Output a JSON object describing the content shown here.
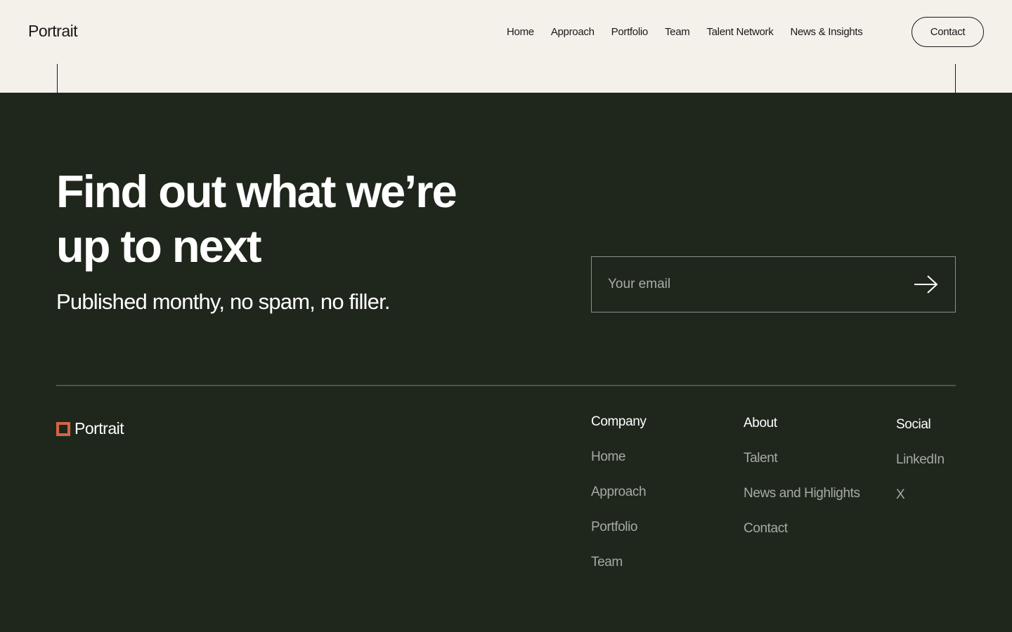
{
  "header": {
    "logo": "Portrait",
    "nav": [
      "Home",
      "Approach",
      "Portfolio",
      "Team",
      "Talent Network",
      "News & Insights"
    ],
    "contact_label": "Contact"
  },
  "newsletter": {
    "headline": "Find out what we’re up to next",
    "subtext": "Published monthy, no spam, no filler.",
    "email_placeholder": "Your email"
  },
  "footer": {
    "logo": "Portrait",
    "columns": {
      "company": {
        "title": "Company",
        "links": [
          "Home",
          "Approach",
          "Portfolio",
          "Team"
        ]
      },
      "about": {
        "title": "About",
        "links": [
          "Talent",
          "News and Highlights",
          "Contact"
        ]
      },
      "social": {
        "title": "Social",
        "links": [
          "LinkedIn",
          "X"
        ]
      }
    }
  },
  "colors": {
    "header_bg": "#f4f0ea",
    "footer_bg": "#1f271d",
    "logo_accent": "#d36545",
    "muted_link": "#a6aaa3"
  },
  "icons": [
    "logo-square-icon",
    "arrow-right-icon"
  ]
}
